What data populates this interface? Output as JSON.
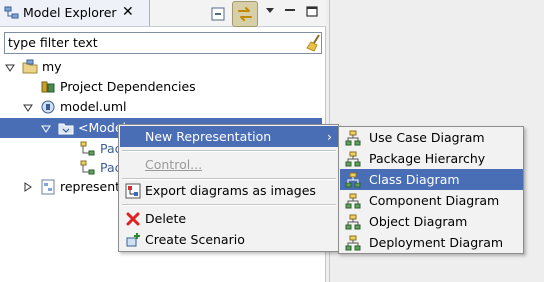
{
  "view": {
    "tab_title": "Model Explorer",
    "tab_icon": "model-explorer-icon",
    "close_glyph": "✕",
    "toolbar": {
      "collapse_icon": "collapse-all-icon",
      "link_icon": "link-with-editor-icon",
      "view_menu_icon": "view-menu-icon",
      "minimize_icon": "minimize-icon",
      "maximize_icon": "maximize-icon"
    }
  },
  "filter": {
    "value": "type filter text",
    "clear_icon": "broom-icon"
  },
  "tree": {
    "my": "my",
    "project_dependencies": "Project Dependencies",
    "model_uml": "model.uml",
    "model": "<Model>",
    "child1": "Pac",
    "child2": "Pac",
    "representations": "represent"
  },
  "context_menu": {
    "new_representation": "New Representation",
    "control": "Control...",
    "export_diagrams": "Export diagrams as images",
    "delete": "Delete",
    "create_scenario": "Create Scenario",
    "submenu_arrow": "›"
  },
  "submenu": {
    "items": [
      "Use Case Diagram",
      "Package Hierarchy",
      "Class Diagram",
      "Component Diagram",
      "Object Diagram",
      "Deployment Diagram"
    ],
    "highlighted": "Class Diagram"
  },
  "colors": {
    "selection": "#4a6eb6",
    "menu_background": "#f2f2f2",
    "disabled_text": "#9a9a9a"
  }
}
